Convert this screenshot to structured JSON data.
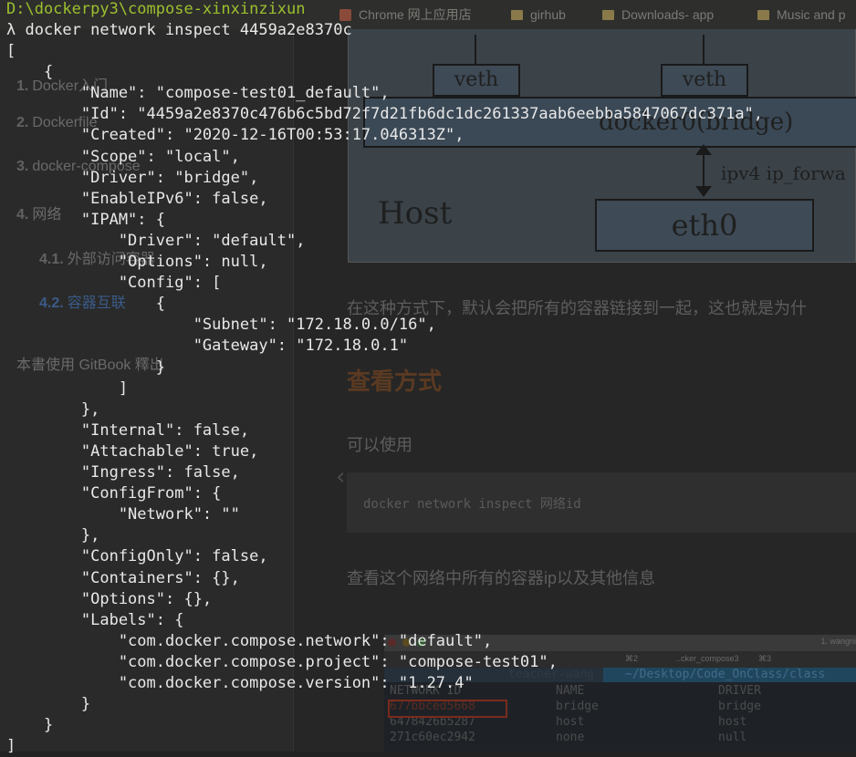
{
  "browser": {
    "bookmarks": [
      {
        "label": "Chrome 网上应用店",
        "icon": "apps-icon"
      },
      {
        "label": "girhub",
        "icon": "folder-icon"
      },
      {
        "label": "Downloads- app",
        "icon": "folder-icon"
      },
      {
        "label": "Music and p",
        "icon": "folder-icon"
      }
    ]
  },
  "sidebar": {
    "items": [
      {
        "num": "1.",
        "label": "Docker入门"
      },
      {
        "num": "2.",
        "label": "Dockerfile"
      },
      {
        "num": "3.",
        "label": "docker-compose"
      },
      {
        "num": "4.",
        "label": "网络"
      },
      {
        "num": "4.1.",
        "label": "外部访问容器"
      },
      {
        "num": "4.2.",
        "label": "容器互联"
      }
    ],
    "footer": "本書使用 GitBook 釋出"
  },
  "page": {
    "diagram": {
      "veth_left": "veth",
      "veth_right": "veth",
      "bridge": "docker0(bridge)",
      "ip_forward": "ipv4 ip_forwa",
      "host": "Host",
      "eth0": "eth0"
    },
    "paragraph": "在这种方式下，默认会把所有的容器链接到一起，这也就是为什",
    "heading": "查看方式",
    "use_text": "可以使用",
    "code": "docker network inspect 网络id",
    "info_text": "查看这个网络中所有的容器ip以及其他信息",
    "screenshot": {
      "title_right": "1. wangni",
      "tab1": "⌘2",
      "tab2": "..cker_compose3",
      "tab3": "⌘3",
      "prompt_user": "teacher-wang",
      "prompt_path": "~/Desktop/Code_OnClass/class",
      "header": [
        "NETWORK ID",
        "NAME",
        "DRIVER"
      ],
      "rows": [
        [
          "677bbced5668",
          "bridge",
          "bridge"
        ],
        [
          "6478426b5287",
          "host",
          "host"
        ],
        [
          "271c60ec2942",
          "none",
          "null"
        ]
      ]
    }
  },
  "terminal": {
    "path_line": "D:\\dockerpy3\\compose-xinxinzixun",
    "command_line": "λ docker network inspect 4459a2e8370c",
    "output": [
      "[",
      "    {",
      "        \"Name\": \"compose-test01_default\",",
      "        \"Id\": \"4459a2e8370c476b6c5bd72f7d21fb6dc1dc261337aab6eebba5847067dc371a\",",
      "        \"Created\": \"2020-12-16T00:53:17.046313Z\",",
      "        \"Scope\": \"local\",",
      "        \"Driver\": \"bridge\",",
      "        \"EnableIPv6\": false,",
      "        \"IPAM\": {",
      "            \"Driver\": \"default\",",
      "            \"Options\": null,",
      "            \"Config\": [",
      "                {",
      "                    \"Subnet\": \"172.18.0.0/16\",",
      "                    \"Gateway\": \"172.18.0.1\"",
      "                }",
      "            ]",
      "        },",
      "        \"Internal\": false,",
      "        \"Attachable\": true,",
      "        \"Ingress\": false,",
      "        \"ConfigFrom\": {",
      "            \"Network\": \"\"",
      "        },",
      "        \"ConfigOnly\": false,",
      "        \"Containers\": {},",
      "        \"Options\": {},",
      "        \"Labels\": {",
      "            \"com.docker.compose.network\": \"default\",",
      "            \"com.docker.compose.project\": \"compose-test01\",",
      "            \"com.docker.compose.version\": \"1.27.4\"",
      "        }",
      "    }",
      "]"
    ]
  }
}
